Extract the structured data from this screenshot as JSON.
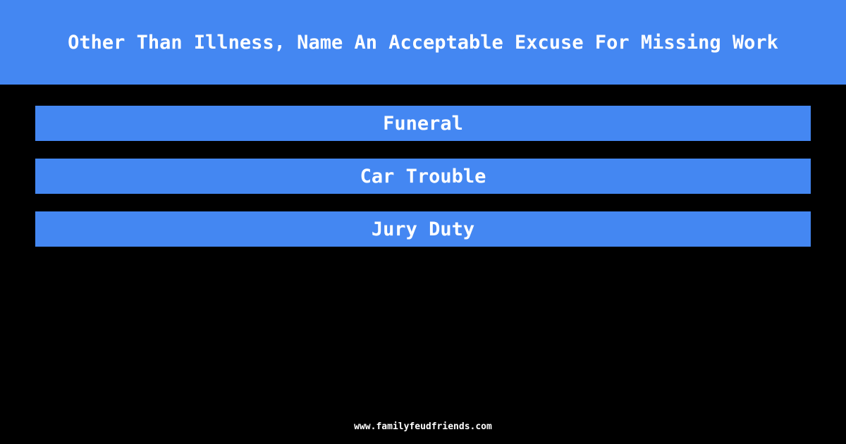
{
  "header": {
    "question": "Other Than Illness, Name An Acceptable Excuse For Missing Work"
  },
  "answers": [
    {
      "label": "Funeral"
    },
    {
      "label": "Car Trouble"
    },
    {
      "label": "Jury Duty"
    }
  ],
  "footer": {
    "site": "www.familyfeudfriends.com"
  },
  "colors": {
    "accent": "#4487f2",
    "background": "#000000",
    "text": "#ffffff"
  }
}
